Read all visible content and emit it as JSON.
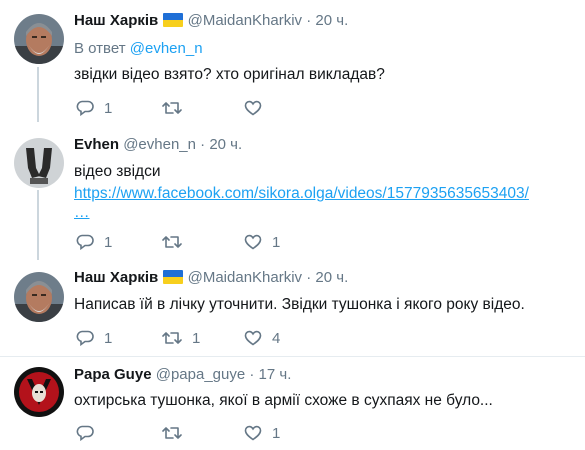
{
  "tweets": [
    {
      "name": "Наш Харків",
      "handle": "@MaidanKharkiv",
      "time": "20 ч.",
      "reply_prefix": "В ответ",
      "reply_handle": "@evhen_n",
      "text": "звідки відео взято? хто оригінал викладав?",
      "replies": "1",
      "retweets": "",
      "likes": ""
    },
    {
      "name": "Evhen",
      "handle": "@evhen_n",
      "time": "20 ч.",
      "text": "відео звідси",
      "link": "https://www.facebook.com/sikora.olga/videos/1577935635653403/",
      "link_more": "…",
      "replies": "1",
      "retweets": "",
      "likes": "1"
    },
    {
      "name": "Наш Харків",
      "handle": "@MaidanKharkiv",
      "time": "20 ч.",
      "text": "Написав їй в лічку уточнити. Звідки тушонка і якого року відео.",
      "replies": "1",
      "retweets": "1",
      "likes": "4"
    },
    {
      "name": "Papa Guye",
      "handle": "@papa_guye",
      "time": "17 ч.",
      "text": "охтирська тушонка, якої в армії схоже в сухпаях не було...",
      "replies": "",
      "retweets": "",
      "likes": "1"
    }
  ],
  "colors": {
    "accent": "#1da1f2",
    "secondary_text": "#657786",
    "divider": "#e6ecf0",
    "thread_line": "#ccd6dd"
  },
  "icons": [
    "reply-icon",
    "retweet-icon",
    "like-icon",
    "ukraine-flag-icon"
  ]
}
